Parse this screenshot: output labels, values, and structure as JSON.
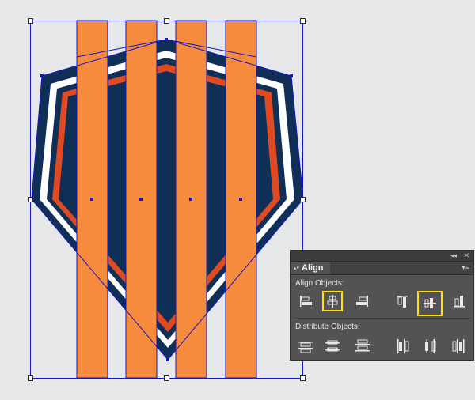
{
  "panel": {
    "tab_label": "Align",
    "tab_arrows": "▴▾",
    "collapse_glyph": "◂◂",
    "close_glyph": "✕",
    "menu_glyph": "▾≡",
    "align_objects_label": "Align Objects:",
    "distribute_objects_label": "Distribute Objects:",
    "highlight_color": "#ffe500"
  },
  "align_buttons": [
    {
      "name": "horizontal-align-left-icon",
      "highlighted": false
    },
    {
      "name": "horizontal-align-center-icon",
      "highlighted": true
    },
    {
      "name": "horizontal-align-right-icon",
      "highlighted": false
    },
    {
      "name": "vertical-align-top-icon",
      "highlighted": false
    },
    {
      "name": "vertical-align-center-icon",
      "highlighted": true
    },
    {
      "name": "vertical-align-bottom-icon",
      "highlighted": false
    }
  ],
  "distribute_buttons": [
    {
      "name": "vertical-distribute-top-icon"
    },
    {
      "name": "vertical-distribute-center-icon"
    },
    {
      "name": "vertical-distribute-bottom-icon"
    },
    {
      "name": "horizontal-distribute-left-icon"
    },
    {
      "name": "horizontal-distribute-center-icon"
    },
    {
      "name": "horizontal-distribute-right-icon"
    }
  ],
  "artwork": {
    "shield_outer_color": "#0f2f57",
    "shield_stripe_white": "#ffffff",
    "shield_stripe_red": "#e04a23",
    "stripe_color": "#f68b3d",
    "selection_color": "#1515c8",
    "canvas_color": "#e6e7e9"
  }
}
